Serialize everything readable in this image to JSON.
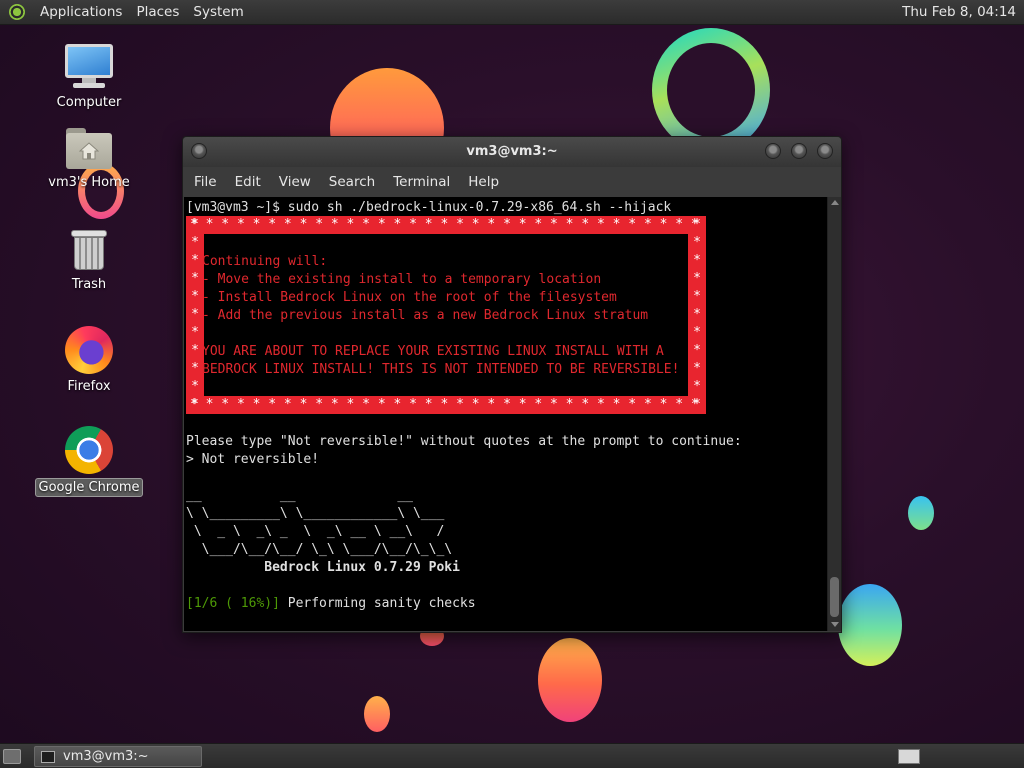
{
  "top_panel": {
    "menus": [
      "Applications",
      "Places",
      "System"
    ],
    "clock": "Thu Feb  8, 04:14"
  },
  "desktop_icons": [
    {
      "label": "Computer",
      "icon": "computer-icon"
    },
    {
      "label": "vm3's Home",
      "icon": "home-folder-icon"
    },
    {
      "label": "Trash",
      "icon": "trash-icon"
    },
    {
      "label": "Firefox",
      "icon": "firefox-icon"
    },
    {
      "label": "Google Chrome",
      "icon": "chrome-icon",
      "selected": true
    }
  ],
  "terminal": {
    "title": "vm3@vm3:~",
    "menu": [
      "File",
      "Edit",
      "View",
      "Search",
      "Terminal",
      "Help"
    ],
    "prompt_line": "[vm3@vm3 ~]$ sudo sh ./bedrock-linux-0.7.29-x86_64.sh --hijack",
    "warning": {
      "star_row": "* * * * * * * * * * * * * * * * * * * * * * * * * * * * * * * * *",
      "star_col": "*\n*\n*\n*\n*\n*\n*\n*\n*\n*\n*",
      "lines": [
        "Continuing will:",
        "- Move the existing install to a temporary location",
        "- Install Bedrock Linux on the root of the filesystem",
        "- Add the previous install as a new Bedrock Linux stratum",
        "YOU ARE ABOUT TO REPLACE YOUR EXISTING LINUX INSTALL WITH A",
        "BEDROCK LINUX INSTALL! THIS IS NOT INTENDED TO BE REVERSIBLE!"
      ],
      "color": "#e8252f"
    },
    "prompt_text": "Please type \"Not reversible!\" without quotes at the prompt to continue:",
    "prompt_answer": "> Not reversible!",
    "ascii_logo": [
      "__          __             __",
      "\\ \\_________\\ \\____________\\ \\___",
      " \\  _ \\  _\\ _  \\  _\\ __ \\ __\\   /",
      "  \\___/\\__/\\__/ \\_\\ \\___/\\__/\\_\\_\\"
    ],
    "version_line": "          Bedrock Linux 0.7.29 Poki",
    "progress_prefix": "[1/6 ( 16%)]",
    "progress_text": " Performing sanity checks"
  },
  "bottom_panel": {
    "taskbar_item": "vm3@vm3:~"
  }
}
